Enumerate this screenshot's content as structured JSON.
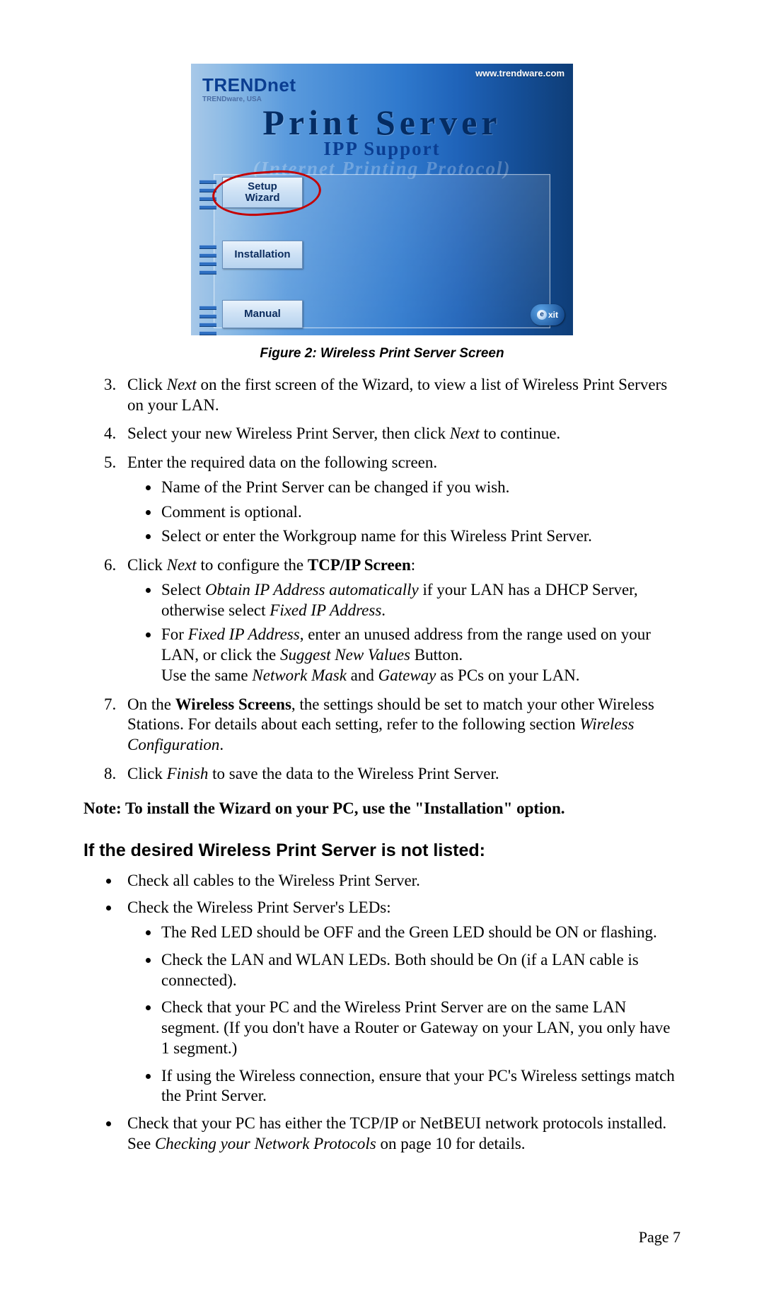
{
  "screenshot": {
    "url": "www.trendware.com",
    "brand": "TRENDnet",
    "brand_sub": "TRENDware, USA",
    "title": "Print Server",
    "subtitle": "IPP Support",
    "ghost": "(Internet Printing Protocol)",
    "buttons": {
      "setup_l1": "Setup",
      "setup_l2": "Wizard",
      "installation": "Installation",
      "manual": "Manual"
    },
    "exit_e": "e",
    "exit_xit": "xit"
  },
  "caption": "Figure 2: Wireless Print Server Screen",
  "steps": {
    "s3a": "Click ",
    "s3b": "Next",
    "s3c": " on the first screen of the Wizard, to view a list of Wireless Print Servers on your LAN.",
    "s4a": "Select your new Wireless Print Server, then click ",
    "s4b": "Next",
    "s4c": " to continue.",
    "s5": "Enter the required data on the following screen.",
    "s5_b1": "Name of the Print Server can be changed if you wish.",
    "s5_b2": "Comment is optional.",
    "s5_b3": "Select or enter the Workgroup name for this Wireless Print Server.",
    "s6a": "Click ",
    "s6b": "Next",
    "s6c": " to configure the ",
    "s6d": "TCP/IP Screen",
    "s6e": ":",
    "s6_b1a": "Select ",
    "s6_b1b": "Obtain IP Address automatically",
    "s6_b1c": " if your LAN has a DHCP Server, otherwise select ",
    "s6_b1d": "Fixed IP Address",
    "s6_b1e": ".",
    "s6_b2a": "For ",
    "s6_b2b": "Fixed IP Address",
    "s6_b2c": ", enter an unused address from the range used on your LAN, or click the ",
    "s6_b2d": "Suggest New Values",
    "s6_b2e": " Button.",
    "s6_b2f": "Use the same ",
    "s6_b2g": "Network Mask",
    "s6_b2h": " and ",
    "s6_b2i": "Gateway",
    "s6_b2j": " as PCs on your LAN.",
    "s7a": "On the ",
    "s7b": "Wireless Screens",
    "s7c": ", the settings should be set to match your other Wireless Stations. For details about each setting, refer to the following section ",
    "s7d": "Wireless Configuration",
    "s7e": ".",
    "s8a": "Click ",
    "s8b": "Finish",
    "s8c": " to save the data to the Wireless Print Server."
  },
  "note": "Note: To install the Wizard on your PC, use the \"Installation\" option.",
  "subhead": "If the desired Wireless Print Server is not listed:",
  "tb": {
    "t1": "Check all cables to the Wireless Print Server.",
    "t2": "Check the Wireless Print Server's LEDs:",
    "t2_s1": "The Red LED should be OFF and the Green LED should be ON or flashing.",
    "t2_s2": "Check the LAN and WLAN LEDs. Both should be On (if a LAN cable is connected).",
    "t2_s3": "Check that your PC and the Wireless Print Server are on the same LAN segment. (If you don't have a Router or Gateway on your LAN, you only have 1 segment.)",
    "t2_s4": "If using the Wireless connection, ensure that your PC's Wireless settings match the Print Server.",
    "t3a": "Check that your PC has either the TCP/IP or NetBEUI network protocols installed. See ",
    "t3b": "Checking your Network Protocols",
    "t3c": " on page 10 for details."
  },
  "pagenum": "Page 7"
}
